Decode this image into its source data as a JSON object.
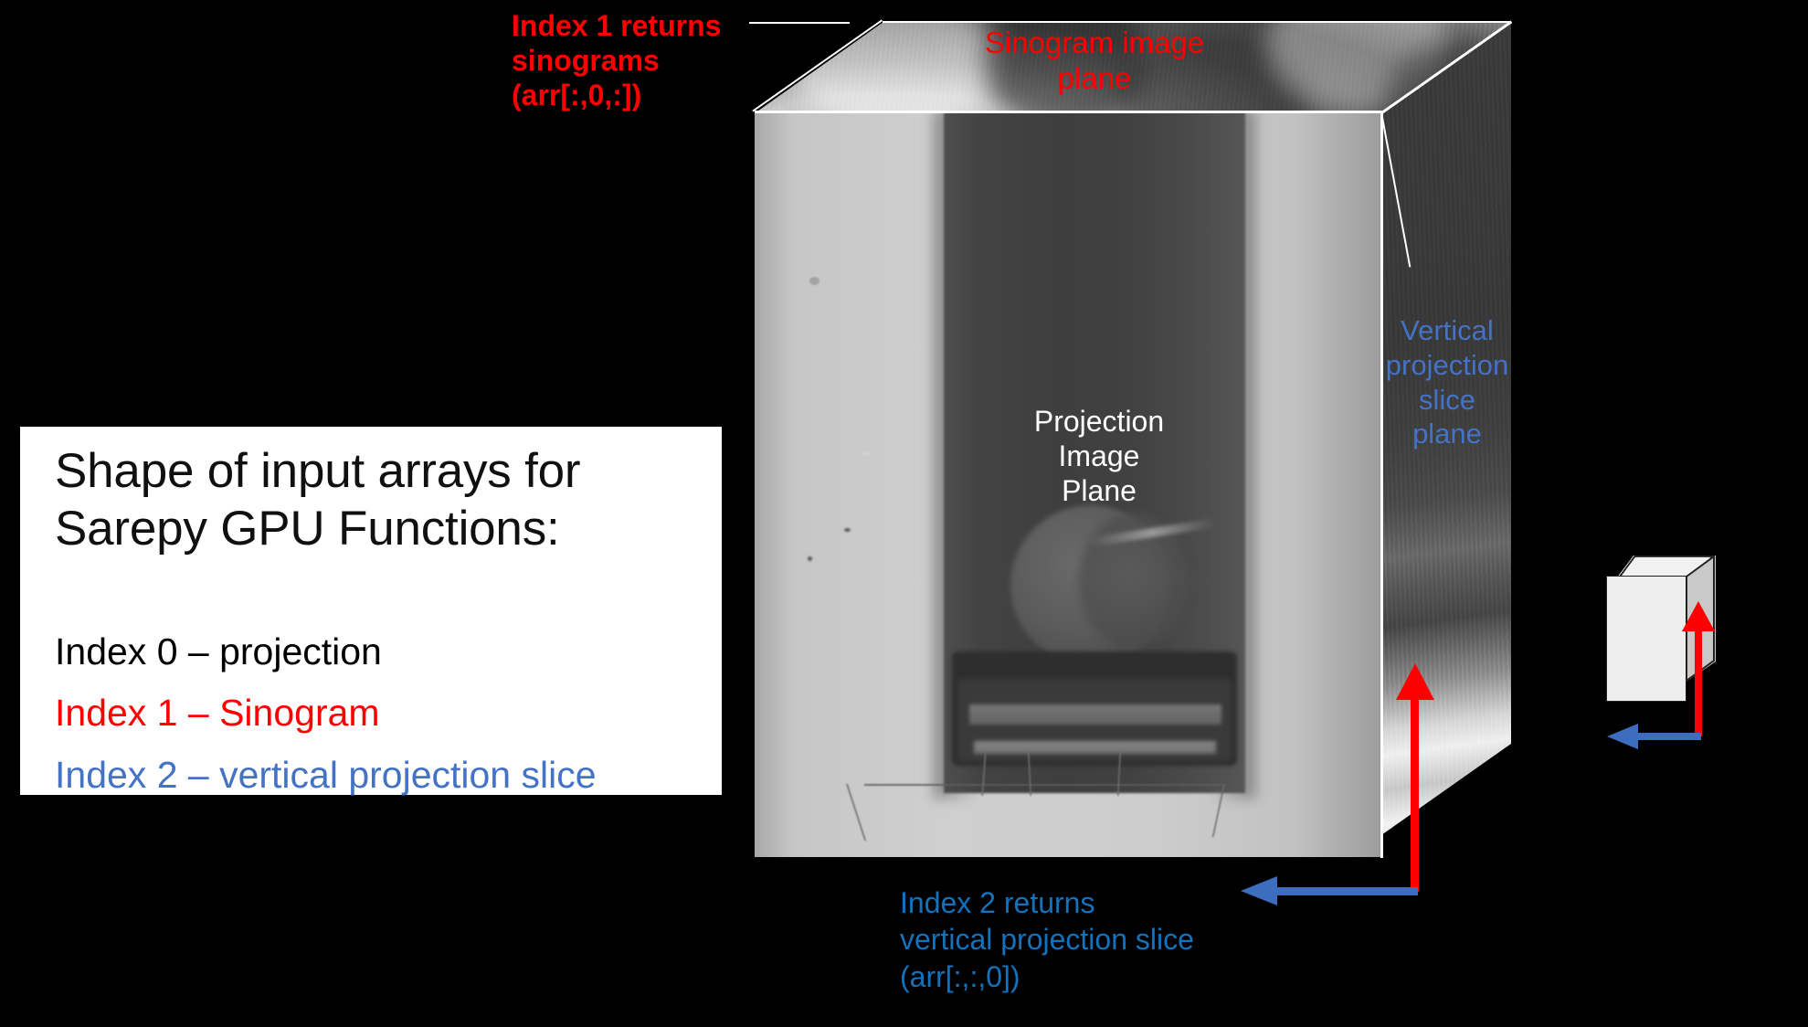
{
  "slide": {
    "background_color": "#000000"
  },
  "annotations": {
    "sinogram_returns": "Index 1 returns\nsinograms\n(arr[:,0,:])",
    "sinogram_plane": "Sinogram image\nplane",
    "projection_plane": "Projection\nImage\nPlane",
    "vertical_plane": "Vertical\nprojection\nslice\nplane",
    "index2_returns": "Index 2 returns\nvertical projection slice\n(arr[:,:,0])"
  },
  "info_card": {
    "title": "Shape of input arrays for Sarepy GPU Functions:",
    "items": [
      {
        "label": "Index 0 – projection",
        "color": "#000000"
      },
      {
        "label": "Index 1 – Sinogram",
        "color": "#FF0000"
      },
      {
        "label": "Index 2 – vertical projection slice",
        "color": "#4472C4"
      }
    ]
  },
  "colors": {
    "red": "#FF0000",
    "blue_light": "#4472C4",
    "blue_dark": "#1272BC",
    "white": "#FFFFFF",
    "black": "#000000"
  },
  "icons": {
    "axis_up_arrow": "red-up-arrow-icon",
    "axis_left_arrow": "blue-left-arrow-icon",
    "reference_cube": "cube-3d-icon"
  },
  "cube": {
    "faces": [
      {
        "name": "projection-image-plane",
        "label": "Projection Image Plane",
        "position": "front"
      },
      {
        "name": "sinogram-image-plane",
        "label": "Sinogram image plane",
        "position": "top"
      },
      {
        "name": "vertical-projection-slice-plane",
        "label": "Vertical projection slice plane",
        "position": "right"
      }
    ]
  }
}
